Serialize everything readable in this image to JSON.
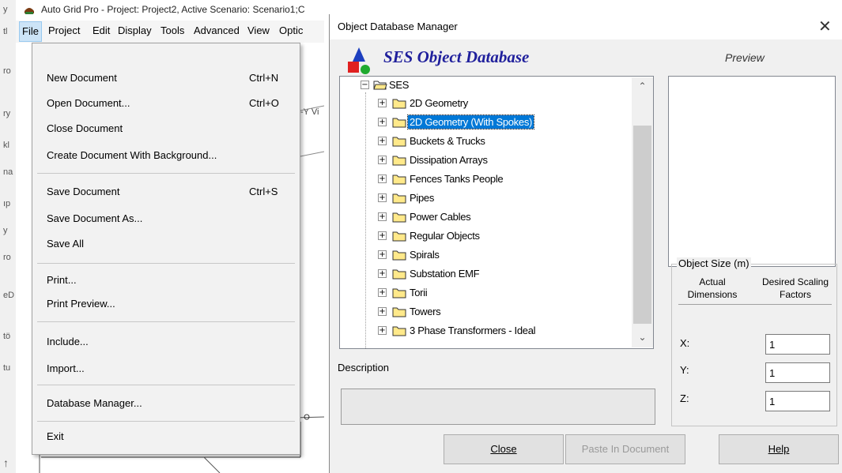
{
  "app": {
    "title": "Auto Grid Pro - Project: Project2, Active Scenario: Scenario1;C",
    "menus": [
      "File",
      "Project",
      "Edit",
      "Display",
      "Tools",
      "Advanced",
      "View",
      "Optic"
    ],
    "left_strip_chars": [
      "y",
      "tl",
      "ro",
      "ry",
      "kl",
      "na",
      "ıp",
      "y",
      "ro",
      "eD",
      "tö",
      "tu"
    ],
    "view_tab_fragment": "-Y Vi"
  },
  "file_menu": {
    "items": [
      {
        "label": "New Document",
        "shortcut": "Ctrl+N"
      },
      {
        "label": "Open Document...",
        "shortcut": "Ctrl+O"
      },
      {
        "label": "Close Document",
        "shortcut": ""
      },
      {
        "label": "Create Document With Background...",
        "shortcut": ""
      },
      {
        "label": "Save Document",
        "shortcut": "Ctrl+S"
      },
      {
        "label": "Save Document As...",
        "shortcut": ""
      },
      {
        "label": "Save All",
        "shortcut": ""
      },
      {
        "label": "Print...",
        "shortcut": ""
      },
      {
        "label": "Print Preview...",
        "shortcut": ""
      },
      {
        "label": "Include...",
        "shortcut": ""
      },
      {
        "label": "Import...",
        "shortcut": ""
      },
      {
        "label": "Database Manager...",
        "shortcut": ""
      },
      {
        "label": "Exit",
        "shortcut": ""
      }
    ]
  },
  "dialog": {
    "title": "Object Database Manager",
    "close_glyph": "✕",
    "heading": "SES Object Database",
    "preview_label": "Preview",
    "tree": {
      "root": "SES",
      "items": [
        {
          "label": "2D Geometry",
          "selected": false
        },
        {
          "label": "2D Geometry (With Spokes)",
          "selected": true
        },
        {
          "label": "Buckets & Trucks",
          "selected": false
        },
        {
          "label": "Dissipation Arrays",
          "selected": false
        },
        {
          "label": "Fences Tanks People",
          "selected": false
        },
        {
          "label": "Pipes",
          "selected": false
        },
        {
          "label": "Power Cables",
          "selected": false
        },
        {
          "label": "Regular Objects",
          "selected": false
        },
        {
          "label": "Spirals",
          "selected": false
        },
        {
          "label": "Substation EMF",
          "selected": false
        },
        {
          "label": "Torii",
          "selected": false
        },
        {
          "label": "Towers",
          "selected": false
        },
        {
          "label": "3 Phase Transformers - Ideal",
          "selected": false
        }
      ],
      "partial_item": "3 Phase Transformers - Ideal"
    },
    "description_label": "Description",
    "description_value": "",
    "object_size": {
      "legend": "Object Size (m)",
      "col_actual": "Actual Dimensions",
      "col_desired": "Desired Scaling Factors",
      "axes": [
        {
          "label": "X:",
          "value": "1"
        },
        {
          "label": "Y:",
          "value": "1"
        },
        {
          "label": "Z:",
          "value": "1"
        }
      ]
    },
    "buttons": {
      "close": "Close",
      "paste": "Paste In Document",
      "help": "Help"
    }
  },
  "colors": {
    "selection": "#0078d7",
    "heading_text": "#1f1f9c",
    "menu_active": "#cce4f7"
  }
}
